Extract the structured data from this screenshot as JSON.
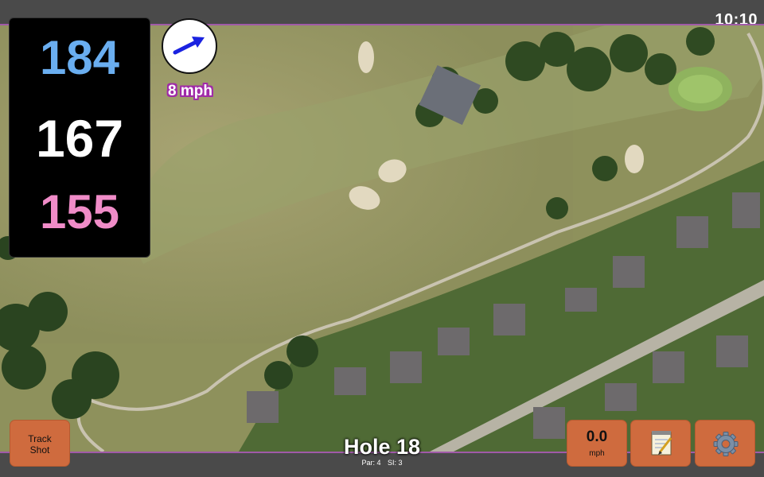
{
  "status": {
    "time": "10:10"
  },
  "distances": {
    "back": "184",
    "middle": "167",
    "front": "155",
    "colors": {
      "back": "#6aaef0",
      "middle": "#ffffff",
      "front": "#f08cc8"
    }
  },
  "wind": {
    "label": "8 mph",
    "arrow_icon": "wind-direction-arrow-icon",
    "arrow_color": "#1a22e0"
  },
  "buttons": {
    "track_shot": {
      "line1": "Track",
      "line2": "Shot"
    },
    "speed": {
      "value": "0.0",
      "unit": "mph"
    },
    "notes_icon": "notepad-icon",
    "settings_icon": "gear-icon"
  },
  "hole": {
    "title": "Hole 18",
    "par": "Par: 4",
    "si": "SI: 3"
  },
  "colors": {
    "button_bg": "#cf6b3e",
    "accent_purple": "#a02aa8"
  }
}
